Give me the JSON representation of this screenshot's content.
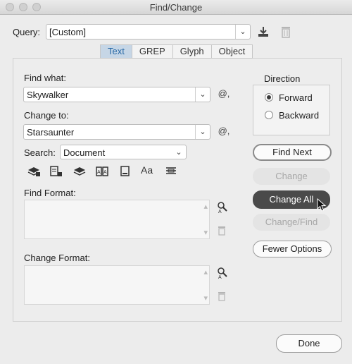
{
  "window": {
    "title": "Find/Change"
  },
  "query": {
    "label": "Query:",
    "value": "[Custom]"
  },
  "tabs": [
    {
      "label": "Text",
      "active": true
    },
    {
      "label": "GREP",
      "active": false
    },
    {
      "label": "Glyph",
      "active": false
    },
    {
      "label": "Object",
      "active": false
    }
  ],
  "find_what": {
    "label": "Find what:",
    "value": "Skywalker"
  },
  "change_to": {
    "label": "Change to:",
    "value": "Starsaunter"
  },
  "search": {
    "label": "Search:",
    "value": "Document"
  },
  "find_format": {
    "label": "Find Format:"
  },
  "change_format": {
    "label": "Change Format:"
  },
  "direction": {
    "label": "Direction",
    "options": [
      {
        "label": "Forward",
        "selected": true
      },
      {
        "label": "Backward",
        "selected": false
      }
    ]
  },
  "buttons": {
    "find_next": "Find Next",
    "change": "Change",
    "change_all": "Change All",
    "change_find": "Change/Find",
    "fewer_options": "Fewer Options",
    "done": "Done"
  },
  "icons": {
    "aa": "Aa",
    "special_char": "@,"
  }
}
